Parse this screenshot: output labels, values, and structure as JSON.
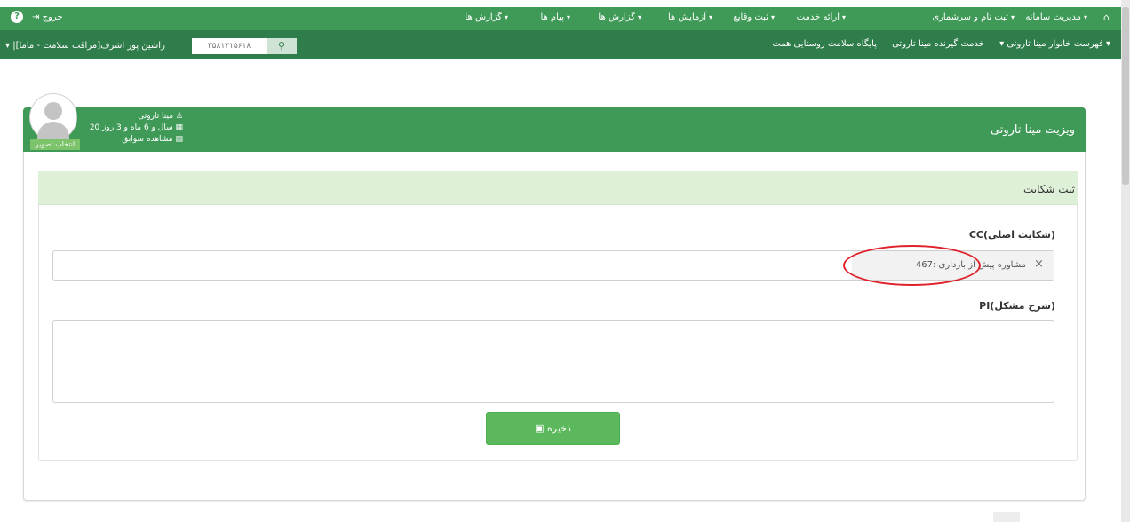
{
  "topnav": {
    "items": [
      {
        "label": "مدیریت سامانه",
        "caret": "▾"
      },
      {
        "label": "ثبت نام و سرشماری",
        "caret": "▾"
      },
      {
        "label": "ارائه خدمت",
        "caret": "▾"
      },
      {
        "label": "ثبت وقایع",
        "caret": "▾"
      },
      {
        "label": "آزمایش ها",
        "caret": "▾"
      },
      {
        "label": "گزارش ها",
        "caret": "▾"
      },
      {
        "label": "پیام ها",
        "caret": "▾"
      },
      {
        "label": "گزارش ها",
        "caret": "▾"
      }
    ],
    "logout_label": "خروج",
    "help_glyph": "?"
  },
  "subnav": {
    "items": [
      "پایگاه سلامت روستایی همت ▾",
      "خدمت گیرنده مینا تاروتی",
      "فهرست خانوار مینا تاروتی ▾"
    ],
    "role_text": "▾ |راشین پور اشرف[مراقب سلامت - ماما]",
    "phone_text": "۳۵۸۱۲۱۵۶۱۸"
  },
  "patient": {
    "name": "مینا تاروتی",
    "age": "20 سال و 6 ماه و 3 روز",
    "history_link": "مشاهده سوابق",
    "change_photo": "انتخاب تصویر"
  },
  "panel": {
    "title": "ویزیت مینا تاروتی"
  },
  "complaint": {
    "title": "ثبت شکایت",
    "cc_label": "CC(شکایت اصلی)",
    "cc_value": "467: مشاوره پیش از بارداری",
    "cc_remove": "×",
    "pi_label": "PI(شرح مشکل)",
    "pi_value": "",
    "save_label": "ذخیره"
  },
  "colors": {
    "nav_green": "#3f9a57",
    "subnav_green": "#2f7d4a",
    "header_light_green": "#dff0d8",
    "save_green": "#5cb85c",
    "annotation_red": "#e0212a"
  }
}
